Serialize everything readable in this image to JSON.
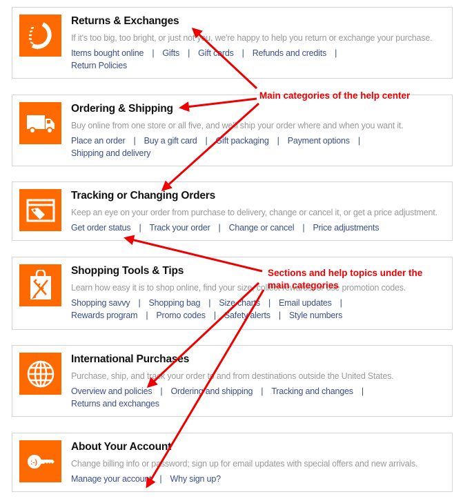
{
  "categories": [
    {
      "icon": "returns-icon",
      "title": "Returns & Exchanges",
      "description": "If it's too big, too bright, or just not you, we're happy to help you return or exchange your purchase.",
      "links": [
        "Items bought online",
        "Gifts",
        "Gift cards",
        "Refunds and credits",
        "Return Policies"
      ],
      "line_break_after": 3
    },
    {
      "icon": "truck-icon",
      "title": "Ordering & Shipping",
      "description": "Buy online from one store or all five, and we'll ship your order where and when you want it.",
      "links": [
        "Place an order",
        "Buy a gift card",
        "Gift packaging",
        "Payment options",
        "Shipping and delivery"
      ],
      "line_break_after": 3
    },
    {
      "icon": "price-tag-icon",
      "title": "Tracking or Changing Orders",
      "description": "Keep an eye on your order from purchase to delivery, change or cancel it, or get a price adjustment.",
      "links": [
        "Get order status",
        "Track your order",
        "Change or cancel",
        "Price adjustments"
      ],
      "line_break_after": null
    },
    {
      "icon": "shopping-tools-icon",
      "title": "Shopping Tools & Tips",
      "description": "Learn how easy it is to shop online, find your size, collect rewards, or use promotion codes.",
      "links": [
        "Shopping savvy",
        "Shopping bag",
        "Size charts",
        "Email updates",
        "Rewards program",
        "Promo codes",
        "Safety alerts",
        "Style numbers"
      ],
      "line_break_after": 3
    },
    {
      "icon": "globe-icon",
      "title": "International Purchases",
      "description": "Purchase, ship, and track your order to and from destinations outside the United States.",
      "links": [
        "Overview and policies",
        "Ordering and shipping",
        "Tracking and changes",
        "Returns and exchanges"
      ],
      "line_break_after": 2
    },
    {
      "icon": "key-icon",
      "title": "About Your Account",
      "description": "Change billing info or password; sign up for email updates with special offers and new arrivals.",
      "links": [
        "Manage your account",
        "Why sign up?"
      ],
      "line_break_after": null
    }
  ],
  "separator": "|",
  "annotations": {
    "main_categories": "Main categories of the help center",
    "sections_line1": "Sections and help topics under the",
    "sections_line2": "main categories"
  },
  "colors": {
    "icon_bg": "#ff6a00",
    "link": "#3a4f8c",
    "annotation": "#ee0000"
  }
}
